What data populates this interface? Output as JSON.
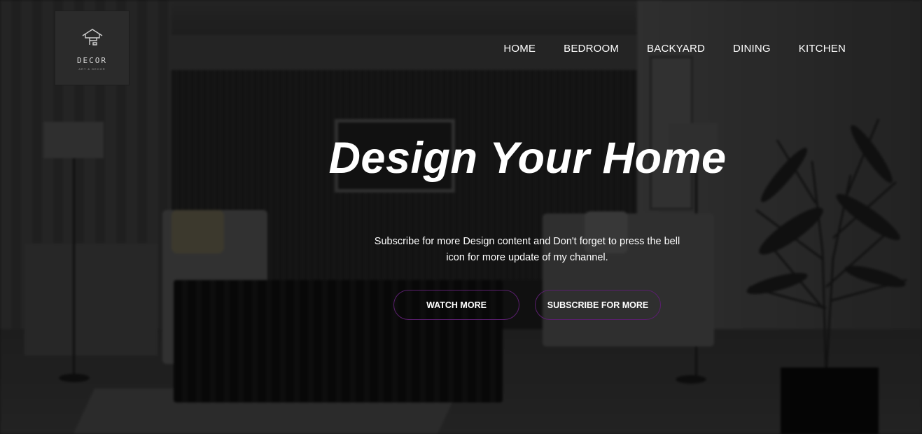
{
  "logo": {
    "name": "DECOR",
    "tagline": "ART & DECOR"
  },
  "nav": {
    "items": [
      {
        "label": "HOME"
      },
      {
        "label": "BEDROOM"
      },
      {
        "label": "BACKYARD"
      },
      {
        "label": "DINING"
      },
      {
        "label": "KITCHEN"
      }
    ]
  },
  "hero": {
    "title": "Design Your Home",
    "subtitle": "Subscribe for more Design content and Don't forget to press the bell icon for more update of my channel.",
    "buttons": {
      "watch_label": "WATCH MORE",
      "subscribe_label": "SUBSCRIBE FOR MORE"
    }
  },
  "colors": {
    "button_border": "#5a1f6e",
    "text": "#ffffff",
    "logo_bg": "#2b2b2b"
  },
  "icons": {
    "logo": "house-icon"
  }
}
